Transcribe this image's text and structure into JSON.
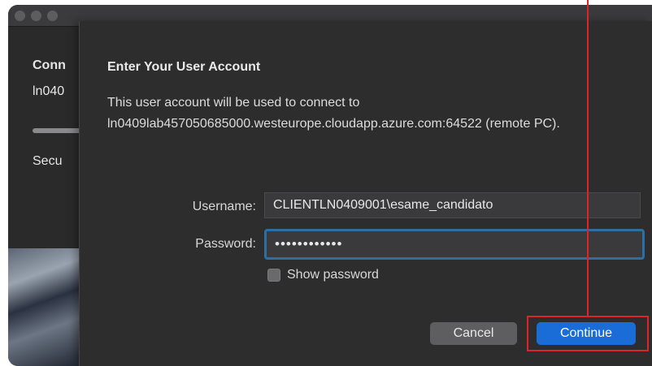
{
  "background_window": {
    "heading": "Conn",
    "host": "ln040",
    "status": "Secu"
  },
  "dialog": {
    "title": "Enter Your User Account",
    "description": "This user account will be used to connect to ln0409lab457050685000.westeurope.cloudapp.azure.com:64522 (remote PC).",
    "username_label": "Username:",
    "username_value": "CLIENTLN0409001\\esame_candidato",
    "password_label": "Password:",
    "password_value": "••••••••••••",
    "show_password_label": "Show password",
    "cancel_label": "Cancel",
    "continue_label": "Continue"
  },
  "colors": {
    "accent": "#1a6dd6",
    "focus_ring": "#2e6fa3",
    "annotation": "#e0232b"
  }
}
